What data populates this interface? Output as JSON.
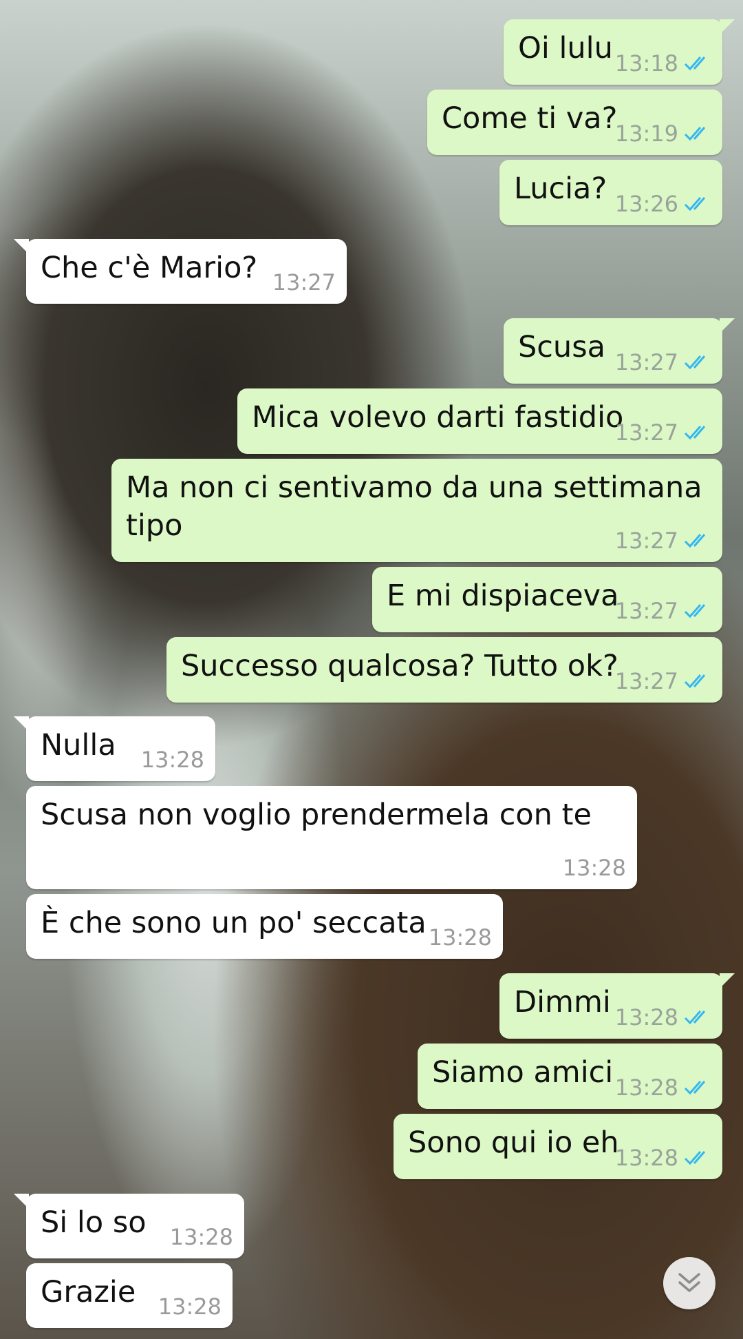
{
  "messages": [
    {
      "text": "Oi lulu",
      "time": "13:18",
      "from": "me"
    },
    {
      "text": "Come ti va?",
      "time": "13:19",
      "from": "me"
    },
    {
      "text": "Lucia?",
      "time": "13:26",
      "from": "me"
    },
    {
      "text": "Che c'è Mario?",
      "time": "13:27",
      "from": "them"
    },
    {
      "text": "Scusa",
      "time": "13:27",
      "from": "me"
    },
    {
      "text": "Mica volevo darti fastidio",
      "time": "13:27",
      "from": "me"
    },
    {
      "text": "Ma non ci sentivamo da una settimana tipo",
      "time": "13:27",
      "from": "me"
    },
    {
      "text": "E mi dispiaceva",
      "time": "13:27",
      "from": "me"
    },
    {
      "text": "Successo qualcosa? Tutto ok?",
      "time": "13:27",
      "from": "me"
    },
    {
      "text": "Nulla",
      "time": "13:28",
      "from": "them"
    },
    {
      "text": "Scusa non voglio prendermela con te",
      "time": "13:28",
      "from": "them"
    },
    {
      "text": "È che sono un po' seccata",
      "time": "13:28",
      "from": "them"
    },
    {
      "text": "Dimmi",
      "time": "13:28",
      "from": "me"
    },
    {
      "text": "Siamo amici",
      "time": "13:28",
      "from": "me"
    },
    {
      "text": "Sono qui io eh",
      "time": "13:28",
      "from": "me"
    },
    {
      "text": "Si lo so",
      "time": "13:28",
      "from": "them"
    },
    {
      "text": "Grazie",
      "time": "13:28",
      "from": "them"
    }
  ],
  "icons": {
    "read_receipt": "double-check-icon",
    "scroll_down": "double-chevron-down-icon"
  },
  "colors": {
    "outgoing_bubble": "#dcf8c6",
    "incoming_bubble": "#ffffff",
    "read_ticks": "#34b7f1"
  }
}
